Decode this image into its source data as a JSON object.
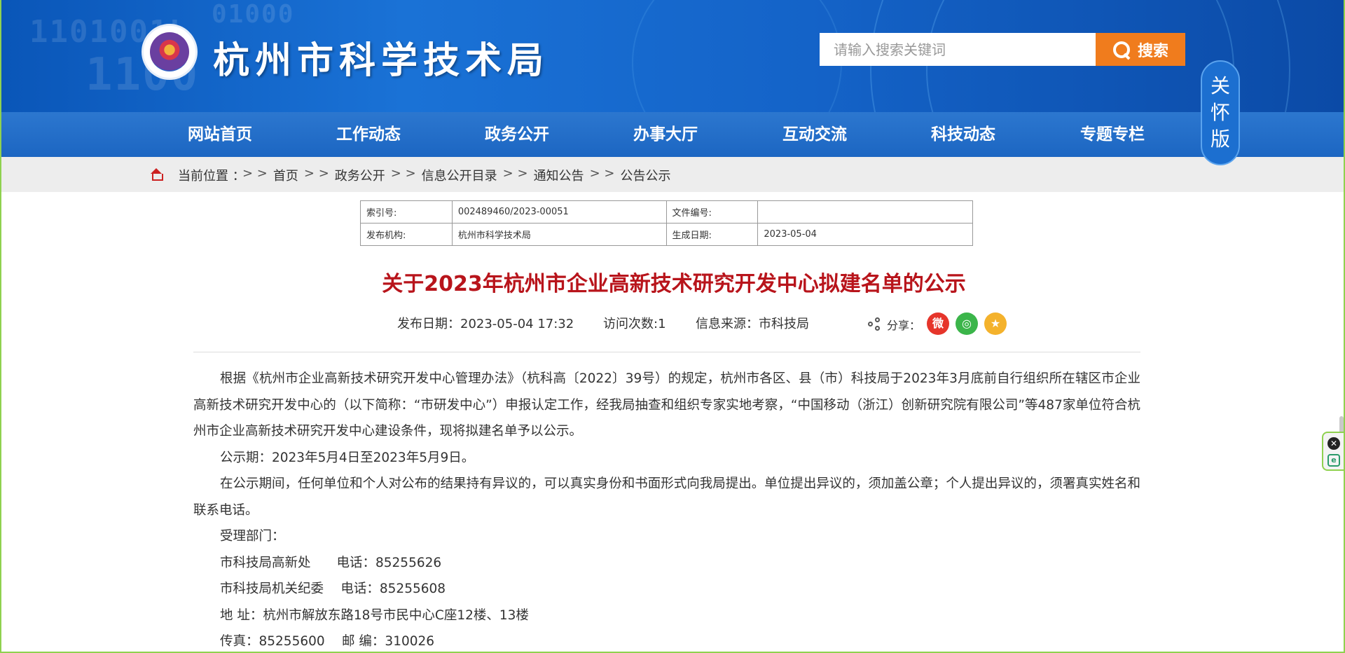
{
  "header": {
    "site_title": "杭州市科学技术局",
    "search_placeholder": "请输入搜索关键词",
    "search_label": "搜索",
    "care_mode_chars": [
      "关",
      "怀",
      "版"
    ]
  },
  "nav": {
    "items": [
      "网站首页",
      "工作动态",
      "政务公开",
      "办事大厅",
      "互动交流",
      "科技动态",
      "专题专栏"
    ]
  },
  "breadcrumb": {
    "label": "当前位置 ：",
    "items": [
      "首页",
      "政务公开",
      "信息公开目录",
      "通知公告",
      "公告公示"
    ],
    "separator": "> >"
  },
  "meta_table": {
    "index_label": "索引号:",
    "index_value": "002489460/2023-00051",
    "doc_no_label": "文件编号:",
    "doc_no_value": "",
    "publisher_label": "发布机构:",
    "publisher_value": "杭州市科学技术局",
    "date_label": "生成日期:",
    "date_value": "2023-05-04"
  },
  "article": {
    "title": "关于2023年杭州市企业高新技术研究开发中心拟建名单的公示",
    "publish_date": "发布日期：2023-05-04 17:32",
    "visits": "访问次数:1",
    "source": "信息来源：市科技局",
    "share_label": "分享：",
    "paragraphs": [
      "根据《杭州市企业高新技术研究开发中心管理办法》（杭科高〔2022〕39号）的规定，杭州市各区、县（市）科技局于2023年3月底前自行组织所在辖区市企业高新技术研究开发中心的（以下简称：“市研发中心”）申报认定工作，经我局抽查和组织专家实地考察，“中国移动（浙江）创新研究院有限公司”等487家单位符合杭州市企业高新技术研究开发中心建设条件，现将拟建名单予以公示。",
      "公示期：2023年5月4日至2023年5月9日。",
      "在公示期间，任何单位和个人对公布的结果持有异议的，可以真实身份和书面形式向我局提出。单位提出异议的，须加盖公章；个人提出异议的，须署真实姓名和联系电话。",
      "受理部门：",
      "市科技局高新处　　电话：85255626",
      "市科技局机关纪委　 电话：85255608",
      "地 址：杭州市解放东路18号市民中心C座12楼、13楼",
      "传真：85255600　  邮 编：310026"
    ]
  },
  "colors": {
    "brand_blue": "#1463c8",
    "search_orange": "#f07c1d",
    "title_red": "#b8141b"
  }
}
